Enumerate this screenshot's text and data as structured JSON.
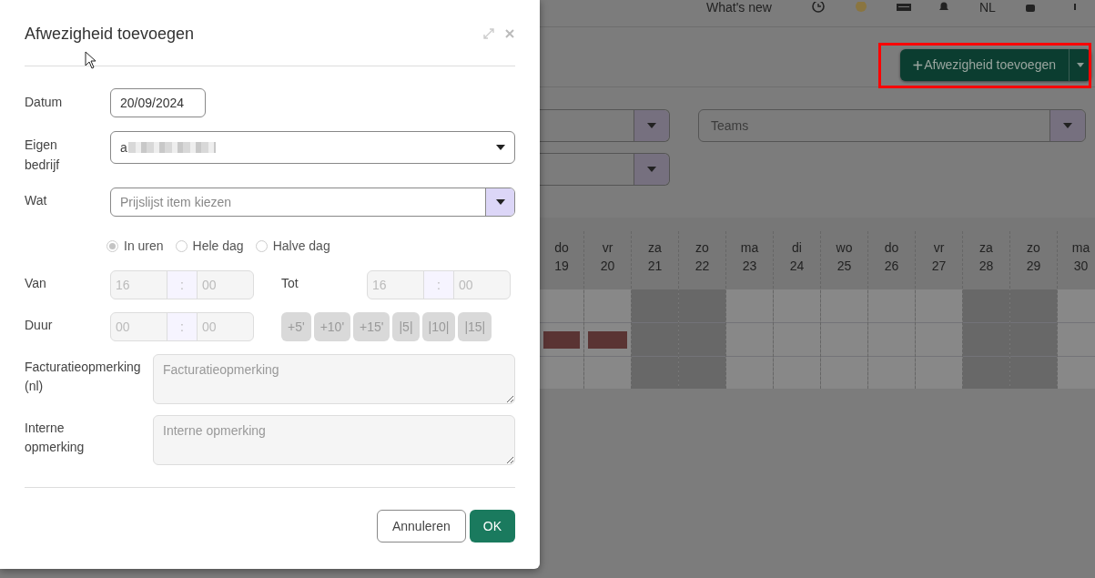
{
  "topbar": {
    "whats_new": "What's new",
    "language": "NL"
  },
  "add_button": {
    "label": "Afwezigheid toevoegen",
    "plus": "+",
    "highlighted": true
  },
  "filters": {
    "teams_placeholder": "Teams"
  },
  "calendar": {
    "days": [
      {
        "day": "do",
        "date": "19",
        "weekend": false,
        "absent": true
      },
      {
        "day": "vr",
        "date": "20",
        "weekend": false,
        "absent": true
      },
      {
        "day": "za",
        "date": "21",
        "weekend": true,
        "absent": false
      },
      {
        "day": "zo",
        "date": "22",
        "weekend": true,
        "absent": false
      },
      {
        "day": "ma",
        "date": "23",
        "weekend": false,
        "absent": false
      },
      {
        "day": "di",
        "date": "24",
        "weekend": false,
        "absent": false
      },
      {
        "day": "wo",
        "date": "25",
        "weekend": false,
        "absent": false
      },
      {
        "day": "do",
        "date": "26",
        "weekend": false,
        "absent": false
      },
      {
        "day": "vr",
        "date": "27",
        "weekend": false,
        "absent": false
      },
      {
        "day": "za",
        "date": "28",
        "weekend": true,
        "absent": false
      },
      {
        "day": "zo",
        "date": "29",
        "weekend": true,
        "absent": false
      },
      {
        "day": "ma",
        "date": "30",
        "weekend": false,
        "absent": false
      }
    ]
  },
  "dialog": {
    "title": "Afwezigheid toevoegen",
    "date_label": "Datum",
    "date_value": "20/09/2024",
    "company_label": "Eigen bedrijf",
    "company_value": "a",
    "company_redacted": true,
    "what_label": "Wat",
    "what_placeholder": "Prijslijst item kiezen",
    "modes": [
      {
        "label": "In uren",
        "selected": true
      },
      {
        "label": "Hele dag",
        "selected": false
      },
      {
        "label": "Halve dag",
        "selected": false
      }
    ],
    "from_label": "Van",
    "from": {
      "hours": "16",
      "sep": ":",
      "minutes": "00"
    },
    "to_label": "Tot",
    "to": {
      "hours": "16",
      "sep": ":",
      "minutes": "00"
    },
    "duration_label": "Duur",
    "duration": {
      "hours": "00",
      "sep": ":",
      "minutes": "00"
    },
    "increments": [
      "+5'",
      "+10'",
      "+15'",
      "|5|",
      "|10|",
      "|15|"
    ],
    "billing_label": "Facturatieopmerking (nl)",
    "billing_placeholder": "Facturatieopmerking",
    "internal_label": "Interne opmerking",
    "internal_placeholder": "Interne opmerking",
    "buttons": [
      {
        "label": "Annuleren",
        "kind": "secondary"
      },
      {
        "label": "OK",
        "kind": "primary"
      }
    ]
  }
}
